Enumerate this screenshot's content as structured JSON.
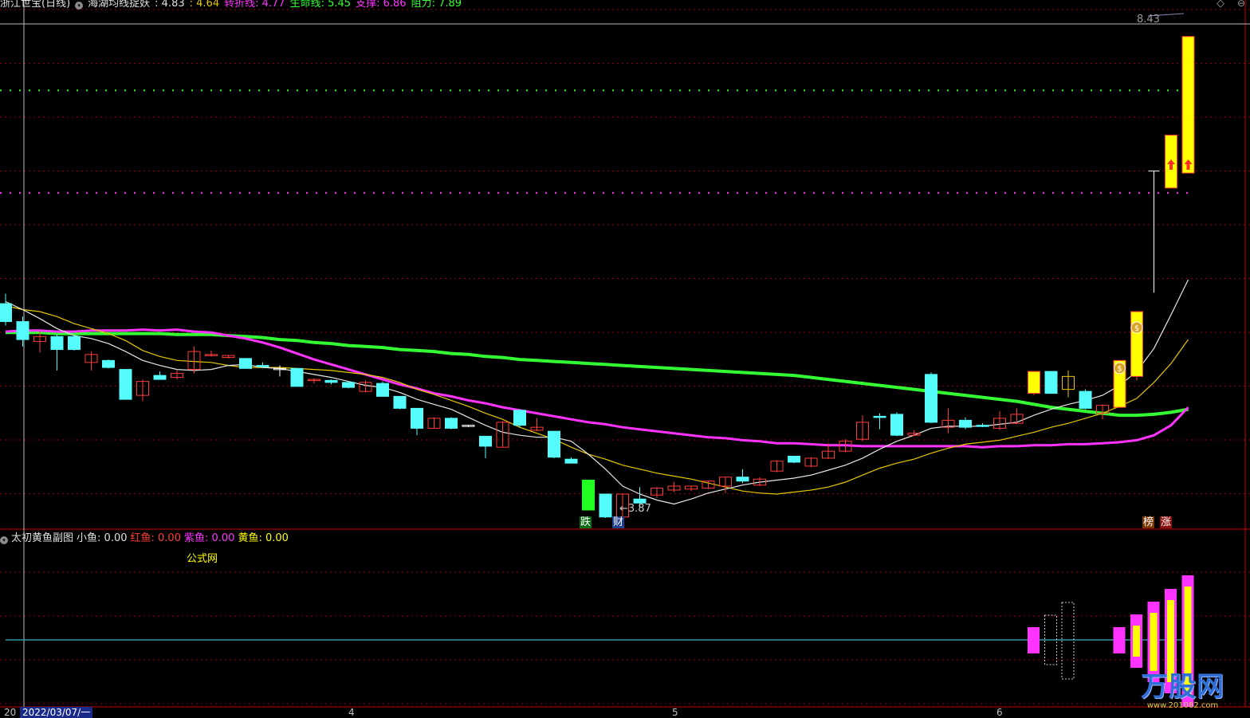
{
  "colors": {
    "bg": "#000000",
    "up": "#ff3b3b",
    "down": "#54fcfc",
    "ma5": "#e6e6e6",
    "ma10": "#e6c800",
    "ma_purple": "#ff33ff",
    "ma_green": "#33ff33",
    "grid": "#8b0000",
    "divider": "#cc0000",
    "sub_level": "#3fb7c4",
    "fish_yellow": "#ffff00",
    "fish_purple": "#ff33ff"
  },
  "header": {
    "stock": "浙江世宝(日线)",
    "indicator": "海湖均线捉妖",
    "v1": ": 4.83",
    "v2": ": 4.64",
    "turn_label": "转折线",
    "turn_value": ": 4.77",
    "life_label": "生命线",
    "life_value": ": 5.45",
    "support_label": "支撑",
    "support_value": ": 6.86",
    "resist_label": "阻力",
    "resist_value": ": 7.89"
  },
  "sub_header": {
    "title": "太初黄鱼副图",
    "small_label": "小鱼",
    "small_value": ": 0.00",
    "red_label": "红鱼",
    "red_value": ": 0.00",
    "purple_label": "紫鱼",
    "purple_value": ": 0.00",
    "yellow_label": "黄鱼",
    "yellow_value": ": 0.00",
    "site": "公式网"
  },
  "markers": {
    "die": "跌",
    "cai": "财",
    "bang": "榜",
    "zhang": "涨",
    "money": "$"
  },
  "price_labels": {
    "high": "8.43",
    "low": "3.87"
  },
  "x_axis": {
    "date": "2022/03/07/一",
    "partial": "20",
    "m4": "4",
    "m5": "5",
    "m6": "6"
  },
  "watermark": {
    "brand": "万股网",
    "url": "www.201082.com"
  },
  "chart_data": {
    "type": "candlestick",
    "ylim": [
      3.6,
      8.7
    ],
    "support_level": 6.86,
    "resist_level": 7.89,
    "candles": [
      {
        "o": 5.75,
        "c": 5.57,
        "h": 5.85,
        "l": 5.53,
        "t": "hollow"
      },
      {
        "o": 5.57,
        "c": 5.39,
        "h": 5.62,
        "l": 5.32,
        "t": "hollow"
      },
      {
        "o": 5.42,
        "c": 5.37,
        "h": 5.48,
        "l": 5.26,
        "t": "up"
      },
      {
        "o": 5.42,
        "c": 5.29,
        "h": 5.44,
        "l": 5.08,
        "t": "down"
      },
      {
        "o": 5.42,
        "c": 5.29,
        "h": 5.44,
        "l": 5.28,
        "t": "down"
      },
      {
        "o": 5.16,
        "c": 5.24,
        "h": 5.27,
        "l": 5.08,
        "t": "up"
      },
      {
        "o": 5.18,
        "c": 5.11,
        "h": 5.19,
        "l": 5.1,
        "t": "down"
      },
      {
        "o": 5.09,
        "c": 4.79,
        "h": 5.09,
        "l": 4.79,
        "t": "down"
      },
      {
        "o": 4.83,
        "c": 4.97,
        "h": 4.99,
        "l": 4.77,
        "t": "up"
      },
      {
        "o": 5.03,
        "c": 4.99,
        "h": 5.07,
        "l": 4.99,
        "t": "down"
      },
      {
        "o": 5.01,
        "c": 5.05,
        "h": 5.09,
        "l": 4.99,
        "t": "up"
      },
      {
        "o": 5.09,
        "c": 5.27,
        "h": 5.32,
        "l": 5.05,
        "t": "up"
      },
      {
        "o": 5.24,
        "c": 5.24,
        "h": 5.28,
        "l": 5.22,
        "t": "up"
      },
      {
        "o": 5.23,
        "c": 5.21,
        "h": 5.23,
        "l": 5.2,
        "t": "up"
      },
      {
        "o": 5.2,
        "c": 5.1,
        "h": 5.2,
        "l": 5.1,
        "t": "down"
      },
      {
        "o": 5.13,
        "c": 5.12,
        "h": 5.16,
        "l": 5.11,
        "t": "down"
      },
      {
        "o": 5.1,
        "c": 5.09,
        "h": 5.13,
        "l": 5.02,
        "t": "doji"
      },
      {
        "o": 5.1,
        "c": 4.92,
        "h": 5.1,
        "l": 4.92,
        "t": "down"
      },
      {
        "o": 4.98,
        "c": 4.99,
        "h": 5.0,
        "l": 4.95,
        "t": "up"
      },
      {
        "o": 4.98,
        "c": 4.96,
        "h": 4.99,
        "l": 4.94,
        "t": "down"
      },
      {
        "o": 4.96,
        "c": 4.91,
        "h": 4.96,
        "l": 4.9,
        "t": "down"
      },
      {
        "o": 4.87,
        "c": 4.96,
        "h": 4.98,
        "l": 4.86,
        "t": "up"
      },
      {
        "o": 4.95,
        "c": 4.82,
        "h": 4.97,
        "l": 4.82,
        "t": "down"
      },
      {
        "o": 4.82,
        "c": 4.7,
        "h": 4.82,
        "l": 4.69,
        "t": "down"
      },
      {
        "o": 4.7,
        "c": 4.5,
        "h": 4.7,
        "l": 4.43,
        "t": "down"
      },
      {
        "o": 4.5,
        "c": 4.6,
        "h": 4.61,
        "l": 4.5,
        "t": "up"
      },
      {
        "o": 4.6,
        "c": 4.5,
        "h": 4.61,
        "l": 4.49,
        "t": "down"
      },
      {
        "o": 4.53,
        "c": 4.53,
        "h": 4.53,
        "l": 4.51,
        "t": "doji"
      },
      {
        "o": 4.42,
        "c": 4.32,
        "h": 4.42,
        "l": 4.2,
        "t": "down"
      },
      {
        "o": 4.31,
        "c": 4.56,
        "h": 4.57,
        "l": 4.31,
        "t": "up"
      },
      {
        "o": 4.53,
        "c": 4.68,
        "h": 4.69,
        "l": 4.51,
        "t": "down"
      },
      {
        "o": 4.48,
        "c": 4.51,
        "h": 4.6,
        "l": 4.47,
        "t": "up"
      },
      {
        "o": 4.47,
        "c": 4.21,
        "h": 4.47,
        "l": 4.2,
        "t": "down"
      },
      {
        "o": 4.19,
        "c": 4.15,
        "h": 4.21,
        "l": 4.15,
        "t": "down"
      },
      {
        "o": 3.98,
        "c": 3.68,
        "h": 3.98,
        "l": 3.68,
        "t": "green"
      },
      {
        "o": 3.84,
        "c": 3.61,
        "h": 3.84,
        "l": 3.6,
        "t": "down"
      },
      {
        "o": 3.61,
        "c": 3.84,
        "h": 3.84,
        "l": 3.53,
        "t": "up"
      },
      {
        "o": 3.79,
        "c": 3.75,
        "h": 3.91,
        "l": 3.7,
        "t": "down"
      },
      {
        "o": 3.83,
        "c": 3.9,
        "h": 3.91,
        "l": 3.8,
        "t": "up"
      },
      {
        "o": 3.88,
        "c": 3.92,
        "h": 3.96,
        "l": 3.86,
        "t": "up"
      },
      {
        "o": 3.89,
        "c": 3.92,
        "h": 3.92,
        "l": 3.87,
        "t": "up"
      },
      {
        "o": 3.9,
        "c": 3.97,
        "h": 3.97,
        "l": 3.89,
        "t": "up"
      },
      {
        "o": 3.92,
        "c": 4.01,
        "h": 4.01,
        "l": 3.85,
        "t": "up"
      },
      {
        "o": 4.01,
        "c": 3.97,
        "h": 4.09,
        "l": 3.95,
        "t": "down"
      },
      {
        "o": 3.93,
        "c": 3.99,
        "h": 4.01,
        "l": 3.92,
        "t": "up"
      },
      {
        "o": 4.07,
        "c": 4.17,
        "h": 4.18,
        "l": 4.06,
        "t": "up"
      },
      {
        "o": 4.16,
        "c": 4.22,
        "h": 4.22,
        "l": 4.15,
        "t": "down"
      },
      {
        "o": 4.12,
        "c": 4.2,
        "h": 4.21,
        "l": 4.11,
        "t": "up"
      },
      {
        "o": 4.2,
        "c": 4.27,
        "h": 4.35,
        "l": 4.19,
        "t": "up"
      },
      {
        "o": 4.27,
        "c": 4.37,
        "h": 4.39,
        "l": 4.26,
        "t": "up"
      },
      {
        "o": 4.39,
        "c": 4.56,
        "h": 4.63,
        "l": 4.37,
        "t": "up"
      },
      {
        "o": 4.61,
        "c": 4.62,
        "h": 4.65,
        "l": 4.49,
        "t": "down"
      },
      {
        "o": 4.64,
        "c": 4.43,
        "h": 4.66,
        "l": 4.42,
        "t": "down"
      },
      {
        "o": 4.43,
        "c": 4.45,
        "h": 4.48,
        "l": 4.42,
        "t": "up"
      },
      {
        "o": 4.56,
        "c": 5.04,
        "h": 5.06,
        "l": 4.55,
        "t": "down"
      },
      {
        "o": 4.58,
        "c": 4.51,
        "h": 4.7,
        "l": 4.45,
        "t": "up"
      },
      {
        "o": 4.58,
        "c": 4.51,
        "h": 4.61,
        "l": 4.49,
        "t": "down"
      },
      {
        "o": 4.53,
        "c": 4.52,
        "h": 4.55,
        "l": 4.51,
        "t": "down"
      },
      {
        "o": 4.5,
        "c": 4.6,
        "h": 4.67,
        "l": 4.48,
        "t": "up"
      },
      {
        "o": 4.55,
        "c": 4.64,
        "h": 4.7,
        "l": 4.54,
        "t": "up"
      },
      {
        "o": 4.85,
        "c": 5.07,
        "h": 5.07,
        "l": 4.83,
        "t": "yellow"
      },
      {
        "o": 4.85,
        "c": 5.07,
        "h": 5.07,
        "l": 4.85,
        "t": "down"
      },
      {
        "o": 4.89,
        "c": 5.02,
        "h": 5.08,
        "l": 4.81,
        "t": "hollowY"
      },
      {
        "o": 4.87,
        "c": 4.7,
        "h": 4.89,
        "l": 4.69,
        "t": "down"
      },
      {
        "o": 4.65,
        "c": 4.73,
        "h": 4.74,
        "l": 4.59,
        "t": "up"
      },
      {
        "o": 4.71,
        "c": 5.18,
        "h": 5.18,
        "l": 4.71,
        "t": "yellow"
      },
      {
        "o": 5.02,
        "c": 5.67,
        "h": 5.67,
        "l": 4.98,
        "t": "yellow"
      },
      {
        "o": 6.07,
        "c": 7.08,
        "h": 7.08,
        "l": 5.86,
        "t": "line"
      },
      {
        "o": 6.91,
        "c": 7.44,
        "h": 7.44,
        "l": 6.91,
        "t": "yellow"
      },
      {
        "o": 7.06,
        "c": 8.43,
        "h": 8.43,
        "l": 7.06,
        "t": "yellow"
      }
    ],
    "ma5": [
      5.77,
      5.69,
      5.6,
      5.5,
      5.43,
      5.4,
      5.35,
      5.27,
      5.18,
      5.13,
      5.09,
      5.08,
      5.09,
      5.13,
      5.14,
      5.11,
      5.1,
      5.07,
      5.04,
      5.01,
      4.97,
      4.93,
      4.91,
      4.86,
      4.79,
      4.74,
      4.69,
      4.61,
      4.53,
      4.46,
      4.43,
      4.41,
      4.41,
      4.37,
      4.24,
      4.09,
      3.92,
      3.84,
      3.78,
      3.74,
      3.79,
      3.85,
      3.89,
      3.93,
      3.96,
      3.98,
      4.0,
      4.03,
      4.08,
      4.13,
      4.2,
      4.29,
      4.37,
      4.43,
      4.5,
      4.52,
      4.52,
      4.52,
      4.54,
      4.56,
      4.63,
      4.69,
      4.74,
      4.78,
      4.83,
      4.93,
      5.07,
      5.3,
      5.64,
      5.99
    ],
    "ma10": [
      5.73,
      5.69,
      5.67,
      5.62,
      5.55,
      5.5,
      5.45,
      5.38,
      5.28,
      5.22,
      5.18,
      5.17,
      5.16,
      5.13,
      5.11,
      5.11,
      5.11,
      5.1,
      5.09,
      5.08,
      5.06,
      5.04,
      5.01,
      4.96,
      4.89,
      4.84,
      4.78,
      4.72,
      4.65,
      4.59,
      4.51,
      4.45,
      4.39,
      4.31,
      4.24,
      4.19,
      4.13,
      4.09,
      4.05,
      4.02,
      3.99,
      3.95,
      3.91,
      3.87,
      3.85,
      3.84,
      3.86,
      3.88,
      3.91,
      3.96,
      4.03,
      4.1,
      4.15,
      4.19,
      4.25,
      4.3,
      4.34,
      4.36,
      4.38,
      4.42,
      4.46,
      4.51,
      4.55,
      4.6,
      4.65,
      4.72,
      4.8,
      4.96,
      5.15,
      5.39
    ],
    "ma_purple": [
      5.47,
      5.48,
      5.48,
      5.47,
      5.47,
      5.48,
      5.48,
      5.48,
      5.49,
      5.48,
      5.49,
      5.47,
      5.46,
      5.43,
      5.4,
      5.36,
      5.31,
      5.25,
      5.19,
      5.14,
      5.09,
      5.04,
      4.99,
      4.94,
      4.9,
      4.85,
      4.82,
      4.78,
      4.75,
      4.71,
      4.68,
      4.65,
      4.62,
      4.59,
      4.56,
      4.54,
      4.51,
      4.49,
      4.47,
      4.45,
      4.43,
      4.41,
      4.4,
      4.38,
      4.37,
      4.35,
      4.35,
      4.34,
      4.33,
      4.33,
      4.32,
      4.32,
      4.32,
      4.32,
      4.32,
      4.32,
      4.32,
      4.31,
      4.32,
      4.32,
      4.33,
      4.33,
      4.34,
      4.34,
      4.35,
      4.36,
      4.38,
      4.43,
      4.53,
      4.71
    ],
    "ma_green": [
      5.46,
      5.46,
      5.46,
      5.45,
      5.45,
      5.45,
      5.45,
      5.45,
      5.45,
      5.45,
      5.44,
      5.44,
      5.44,
      5.43,
      5.42,
      5.41,
      5.39,
      5.38,
      5.36,
      5.35,
      5.33,
      5.32,
      5.31,
      5.29,
      5.28,
      5.27,
      5.25,
      5.24,
      5.22,
      5.21,
      5.19,
      5.18,
      5.17,
      5.16,
      5.15,
      5.14,
      5.13,
      5.12,
      5.11,
      5.1,
      5.09,
      5.08,
      5.07,
      5.06,
      5.05,
      5.04,
      5.03,
      5.01,
      4.99,
      4.97,
      4.95,
      4.93,
      4.91,
      4.89,
      4.87,
      4.85,
      4.83,
      4.81,
      4.79,
      4.77,
      4.74,
      4.71,
      4.69,
      4.67,
      4.65,
      4.63,
      4.63,
      4.64,
      4.66,
      4.69
    ],
    "fish": [
      {
        "i": 60,
        "purple": 1,
        "yellow": 0,
        "dashed": false
      },
      {
        "i": 61,
        "purple": 0,
        "yellow": 0,
        "dashed": true
      },
      {
        "i": 62,
        "purple": 0,
        "yellow": 0,
        "dashed": true
      },
      {
        "i": 65,
        "purple": 1,
        "yellow": 0,
        "dashed": false
      },
      {
        "i": 66,
        "purple": 1,
        "yellow": 1,
        "dashed": false
      },
      {
        "i": 67,
        "purple": 1,
        "yellow": 1,
        "dashed": false
      },
      {
        "i": 68,
        "purple": 1,
        "yellow": 1,
        "dashed": false
      },
      {
        "i": 69,
        "purple": 1,
        "yellow": 1,
        "dashed": false
      }
    ]
  }
}
